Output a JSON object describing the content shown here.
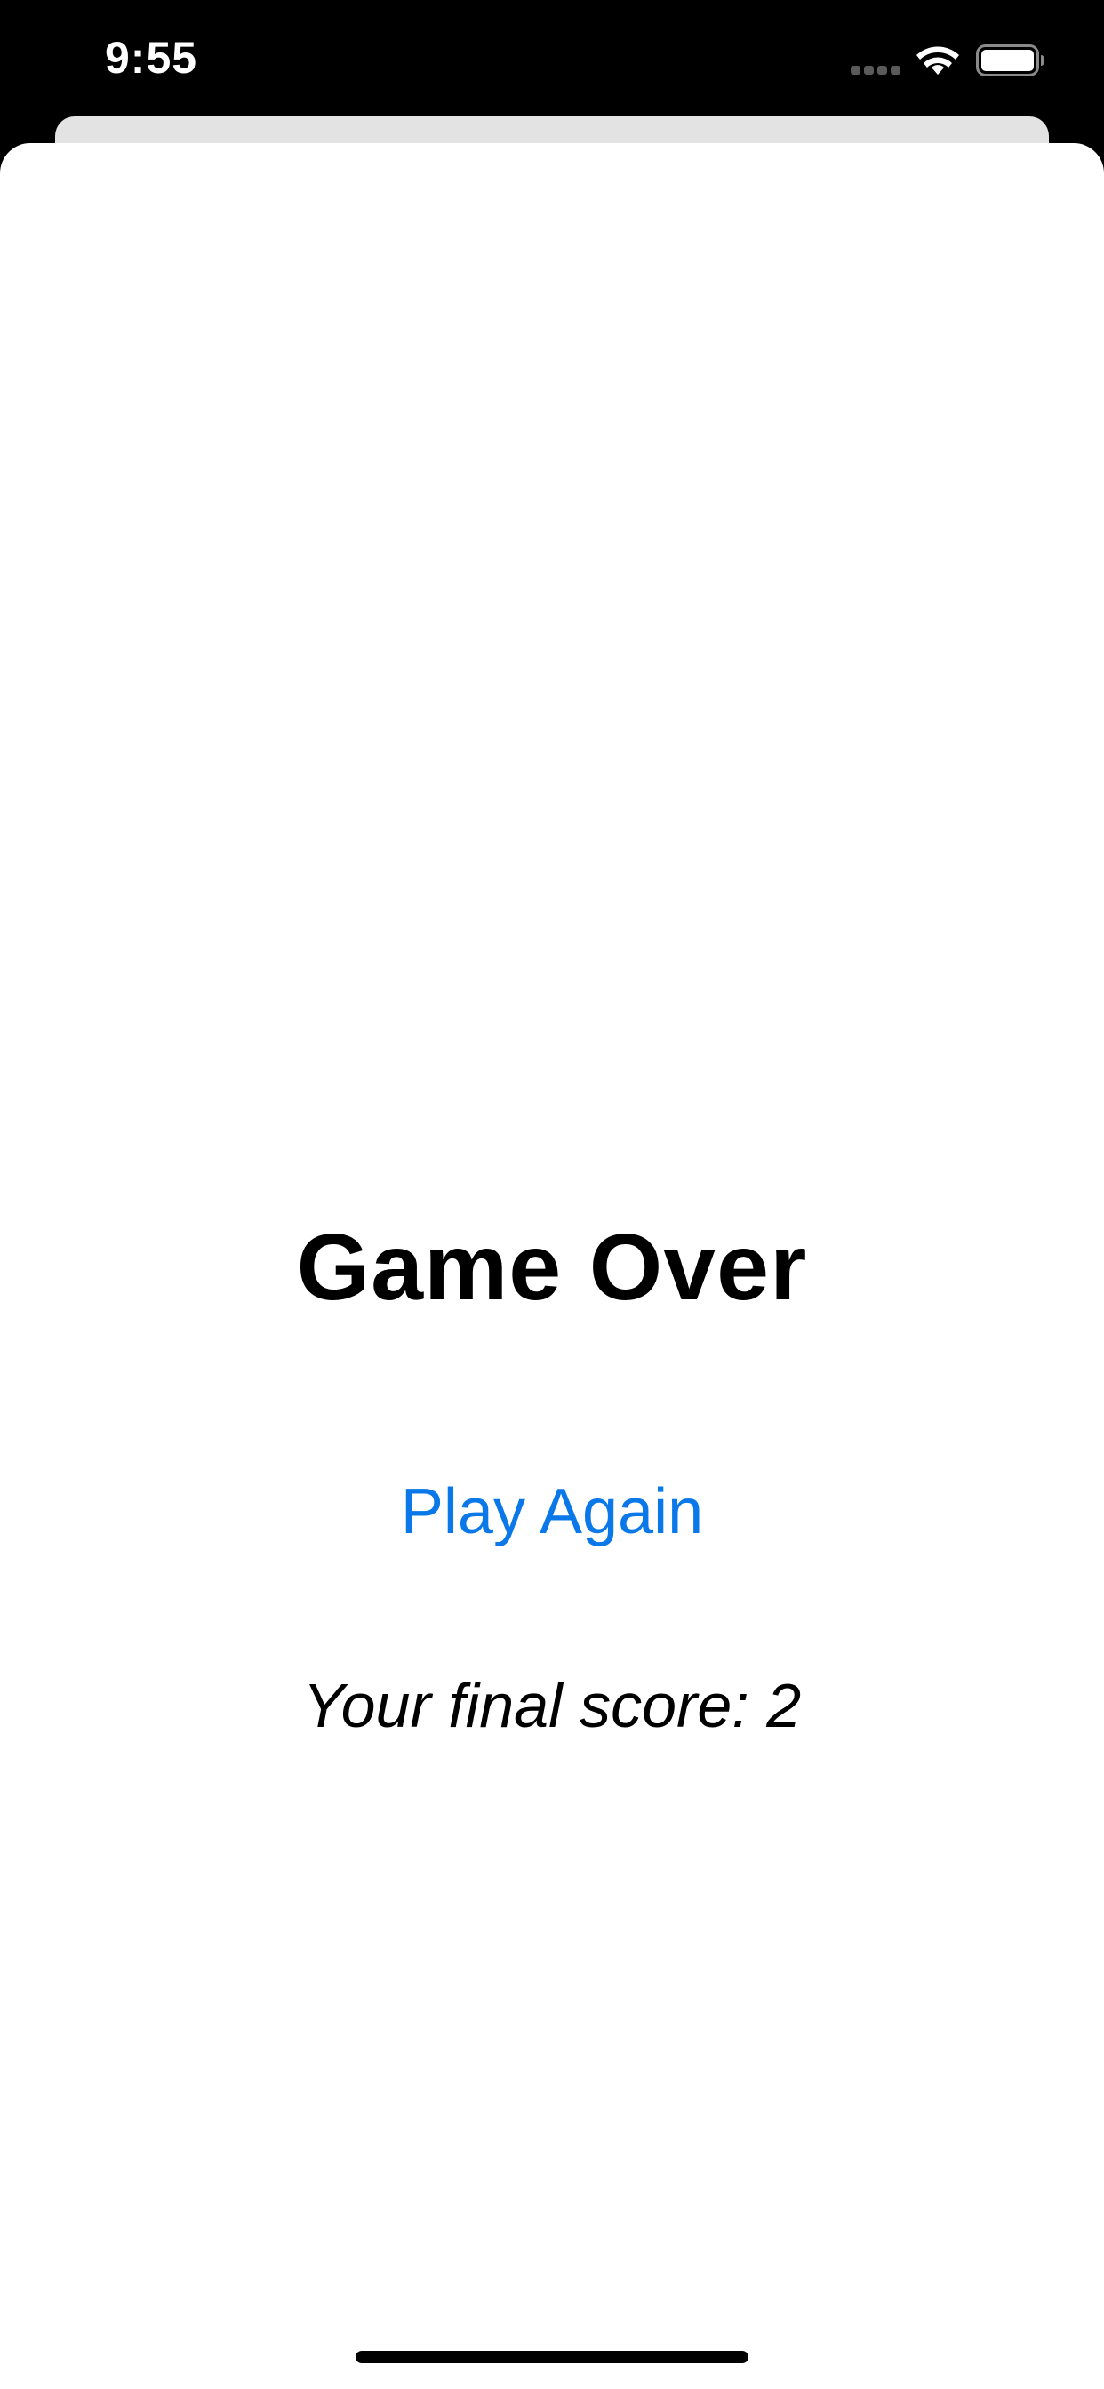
{
  "status_bar": {
    "time": "9:55",
    "icons": [
      "cellular-signal-icon",
      "wifi-icon",
      "battery-icon"
    ]
  },
  "game_over": {
    "title": "Game Over",
    "play_again_label": "Play Again",
    "score_label": "Your final score:",
    "score_value": "2"
  },
  "colors": {
    "accent": "#0a78e8",
    "status_bar_bg": "#000000",
    "sheet_bg": "#ffffff",
    "back_sheet_bg": "#e3e3e3"
  }
}
